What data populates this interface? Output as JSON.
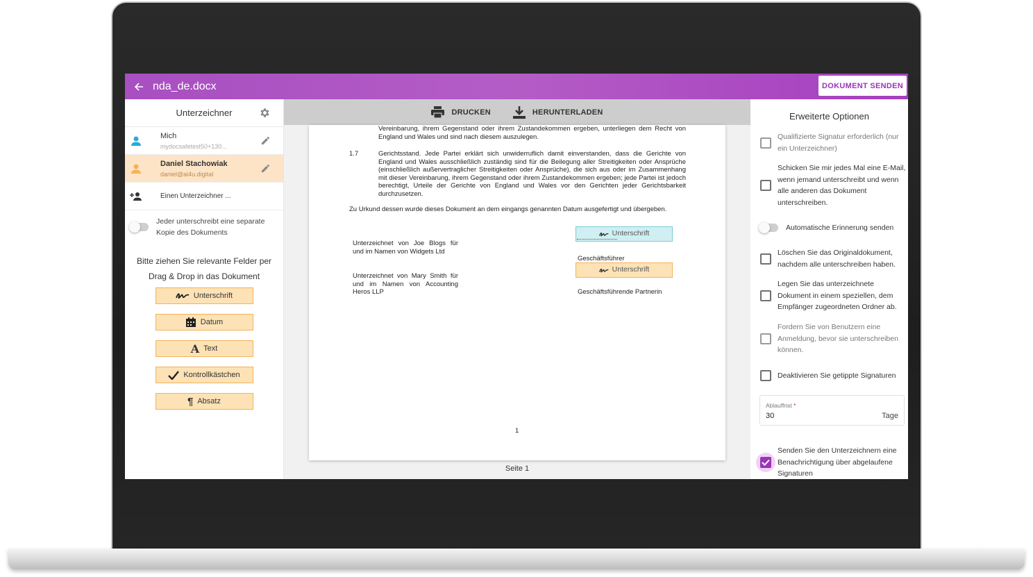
{
  "app": {
    "doc_title": "nda_de.docx",
    "send_label": "DOKUMENT SENDEN"
  },
  "left": {
    "title": "Unterzeichner",
    "signers": [
      {
        "name": "Mich",
        "email": "mydocsafetest50+130...",
        "color": "#29a9d8"
      },
      {
        "name": "Daniel Stachowiak",
        "email": "daniel@ai4u.digital",
        "color": "#f4b25a"
      }
    ],
    "add_signer_label": "Einen Unterzeichner ...",
    "separate_copy_label": "Jeder unterschreibt eine separate Kopie des Dokuments",
    "hint_line1": "Bitte ziehen Sie relevante Felder per",
    "hint_line2": "Drag & Drop in das Dokument",
    "fields": {
      "signature": "Unterschrift",
      "date": "Datum",
      "text": "Text",
      "checkbox": "Kontrollkästchen",
      "paragraph": "Absatz"
    }
  },
  "toolbar": {
    "print_label": "DRUCKEN",
    "download_label": "HERUNTERLADEN"
  },
  "document": {
    "top_text": "Vereinbarung, ihrem Gegenstand oder ihrem Zustandekommen ergeben, unterliegen dem Recht von England und Wales und sind nach diesem auszulegen.",
    "clause_num": "1.7",
    "clause_text": "Gerichtsstand. Jede Partei erklärt sich unwiderruflich damit einverstanden, dass die Gerichte von England und Wales ausschließlich zuständig sind für die Beilegung aller Streitigkeiten oder Ansprüche (einschließlich außervertraglicher Streitigkeiten oder Ansprüche), die sich aus oder im Zusammenhang mit dieser Vereinbarung, ihrem Gegenstand oder ihrem Zustandekommen ergeben; jede Partei ist jedoch berechtigt, Urteile der Gerichte von England und Wales vor den Gerichten jeder Gerichtsbarkeit durchzusetzen.",
    "witness_text": "Zu Urkund dessen wurde dieses Dokument an dem eingangs genannten Datum ausgefertigt und übergeben.",
    "signed_1": "Unterzeichnet von Joe Blogs für und im Namen von Widgets Ltd",
    "signed_2": "Unterzeichnet von Mary Smith für und im Namen von Accounting Heros LLP",
    "sig_field_1": "Unterschrift",
    "sig_field_2": "Unterschrift",
    "role_1": "Geschäftsführer",
    "role_2": "Geschäftsführende Partnerin",
    "page_number": "1",
    "page_label": "Seite 1"
  },
  "right": {
    "title": "Erweiterte Optionen",
    "opt_qualified": "Qualifizierte Signatur erforderlich (nur ein Unterzeichner)",
    "opt_email": "Schicken Sie mir jedes Mal eine E-Mail, wenn jemand unterschreibt und wenn alle anderen das Dokument unterschreiben.",
    "opt_reminder": "Automatische Erinnerung senden",
    "opt_delete": "Löschen Sie das Originaldokument, nachdem alle unterschreiben haben.",
    "opt_folder": "Legen Sie das unterzeichnete Dokument in einem speziellen, dem Empfänger zugeordneten Ordner ab.",
    "opt_login": "Fordern Sie von Benutzern eine Anmeldung, bevor sie unterschreiben können.",
    "opt_typed": "Deaktivieren Sie getippte Signaturen",
    "deadline_label": "Ablauffrist",
    "deadline_required": "*",
    "deadline_value": "30",
    "deadline_unit": "Tage",
    "opt_notify": "Senden Sie den Unterzeichnern eine Benachrichtigung über abgelaufene Signaturen"
  },
  "colors": {
    "accent": "#a84fc1",
    "signer_blue": "#29a9d8",
    "signer_orange": "#f4b25a"
  }
}
